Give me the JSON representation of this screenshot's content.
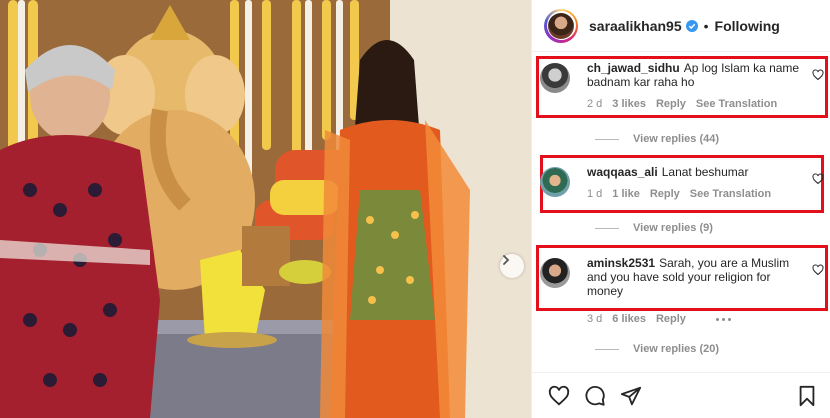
{
  "post": {
    "username": "saraalikhan95",
    "separator": "•",
    "follow_status": "Following"
  },
  "comments": [
    {
      "username": "ch_jawad_sidhu",
      "text": "Ap log Islam ka name badnam kar raha ho",
      "time": "2 d",
      "likes": "3 likes",
      "reply": "Reply",
      "translate": "See Translation",
      "view_replies": "View replies (44)"
    },
    {
      "username": "waqqaas_ali",
      "text": "Lanat beshumar",
      "time": "1 d",
      "likes": "1 like",
      "reply": "Reply",
      "translate": "See Translation",
      "view_replies": "View replies (9)"
    },
    {
      "username": "aminsk2531",
      "text": "Sarah, you are a Muslim and you have sold your religion for money",
      "time": "3 d",
      "likes": "6 likes",
      "reply": "Reply",
      "view_replies": "View replies (20)"
    }
  ],
  "colors": {
    "highlight_box": "#e3101c",
    "muted_text": "#8e8e8e",
    "verified_badge": "#3897f0"
  },
  "icons": {
    "like": "heart-icon",
    "comment": "comment-icon",
    "share": "share-icon",
    "save": "bookmark-icon",
    "next": "chevron-right-icon"
  }
}
